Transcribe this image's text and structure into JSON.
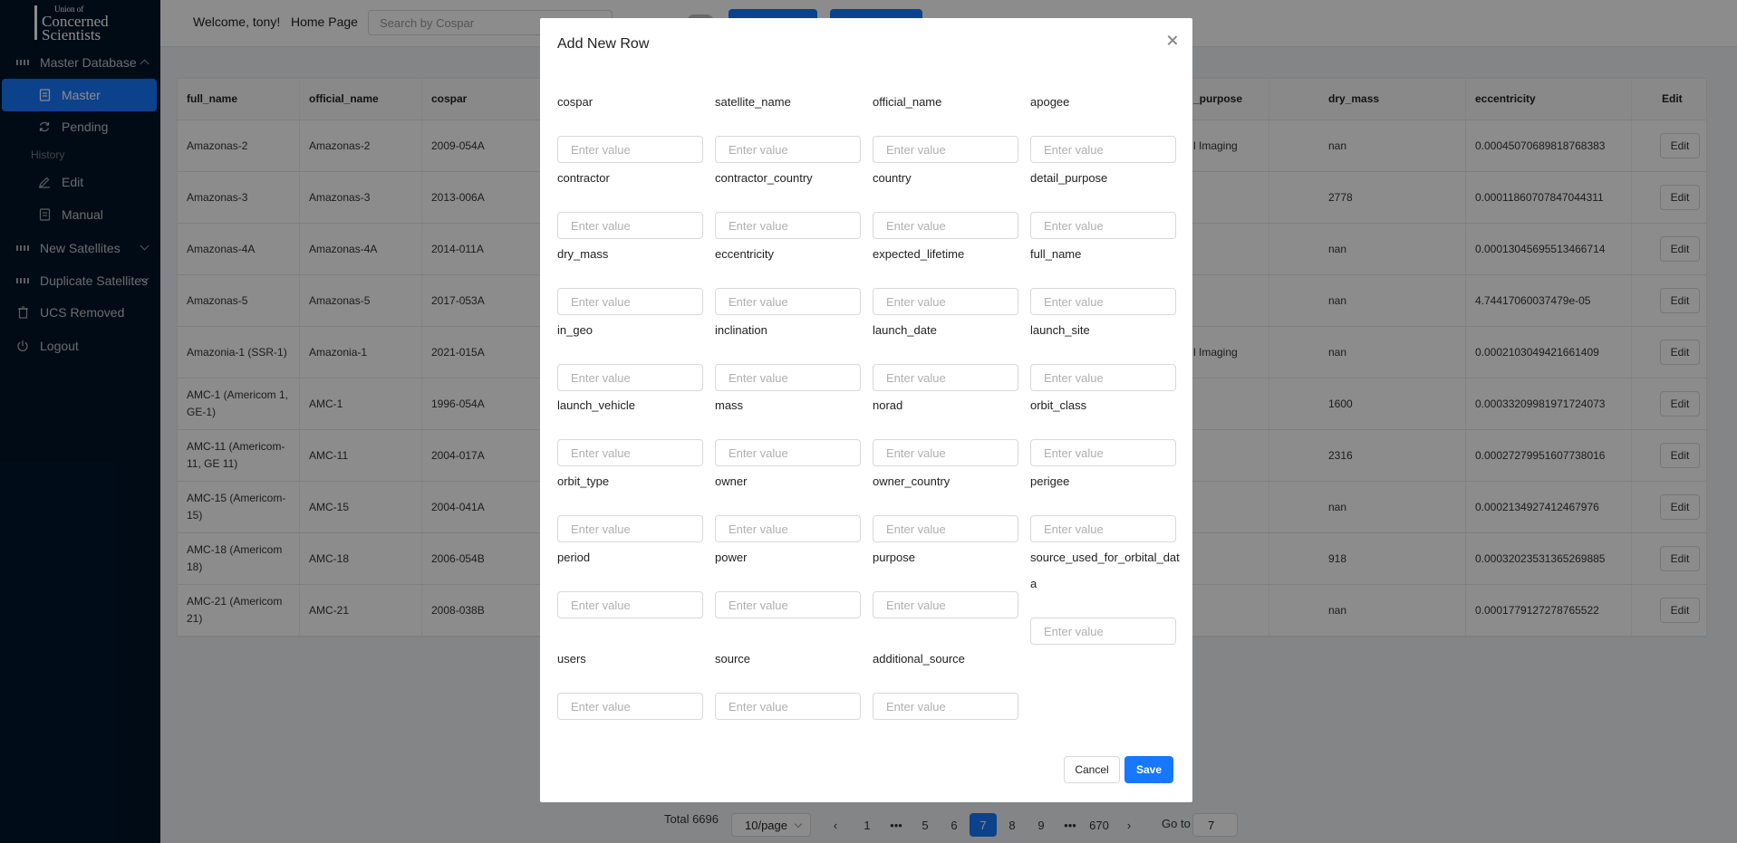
{
  "logo": {
    "line1": "Union of",
    "line2": "Concerned",
    "line3": "Scientists"
  },
  "sidebar": {
    "master_database": "Master Database",
    "master": "Master",
    "pending": "Pending",
    "history_label": "History",
    "edit": "Edit",
    "manual": "Manual",
    "new_satellites": "New Satellites",
    "duplicate_satellites": "Duplicate Satellites",
    "ucs_removed": "UCS Removed",
    "logout": "Logout"
  },
  "header": {
    "welcome": "Welcome, tony!",
    "home": "Home Page",
    "search_placeholder": "Search by Cospar"
  },
  "table": {
    "columns": [
      "full_name",
      "official_name",
      "cospar",
      "_purpose",
      "dry_mass",
      "eccentricity",
      "Edit"
    ],
    "rows": [
      {
        "full_name": "Amazonas-2",
        "official_name": "Amazonas-2",
        "cospar": "2009-054A",
        "purpose": "l Imaging",
        "dry_mass": "nan",
        "eccentricity": "0.00045070689818768383",
        "edit": "Edit"
      },
      {
        "full_name": "Amazonas-3",
        "official_name": "Amazonas-3",
        "cospar": "2013-006A",
        "purpose": "",
        "dry_mass": "2778",
        "eccentricity": "0.00011860707847044311",
        "edit": "Edit"
      },
      {
        "full_name": "Amazonas-4A",
        "official_name": "Amazonas-4A",
        "cospar": "2014-011A",
        "purpose": "",
        "dry_mass": "nan",
        "eccentricity": "0.00013045695513466714",
        "edit": "Edit"
      },
      {
        "full_name": "Amazonas-5",
        "official_name": "Amazonas-5",
        "cospar": "2017-053A",
        "purpose": "",
        "dry_mass": "nan",
        "eccentricity": "4.74417060037479e-05",
        "edit": "Edit"
      },
      {
        "full_name": "Amazonia-1 (SSR-1)",
        "official_name": "Amazonia-1",
        "cospar": "2021-015A",
        "purpose": "l Imaging",
        "dry_mass": "nan",
        "eccentricity": "0.0002103049421661409",
        "edit": "Edit"
      },
      {
        "full_name": "AMC-1 (Americom 1, GE-1)",
        "official_name": "AMC-1",
        "cospar": "1996-054A",
        "purpose": "",
        "dry_mass": "1600",
        "eccentricity": "0.00033209981971724073",
        "edit": "Edit"
      },
      {
        "full_name": "AMC-11 (Americom-11, GE 11)",
        "official_name": "AMC-11",
        "cospar": "2004-017A",
        "purpose": "",
        "dry_mass": "2316",
        "eccentricity": "0.00027279951607738016",
        "edit": "Edit"
      },
      {
        "full_name": "AMC-15 (Americom-15)",
        "official_name": "AMC-15",
        "cospar": "2004-041A",
        "purpose": "",
        "dry_mass": "nan",
        "eccentricity": "0.0002134927412467976",
        "edit": "Edit"
      },
      {
        "full_name": "AMC-18 (Americom 18)",
        "official_name": "AMC-18",
        "cospar": "2006-054B",
        "purpose": "",
        "dry_mass": "918",
        "eccentricity": "0.00032023531365269885",
        "edit": "Edit"
      },
      {
        "full_name": "AMC-21 (Americom 21)",
        "official_name": "AMC-21",
        "cospar": "2008-038B",
        "purpose": "",
        "dry_mass": "nan",
        "eccentricity": "0.0001779127278765522",
        "edit": "Edit"
      }
    ]
  },
  "pagination": {
    "total": "Total 6696",
    "page_size": "10/page",
    "prev": "‹",
    "next": "›",
    "pages": [
      "1",
      "•••",
      "5",
      "6",
      "7",
      "8",
      "9",
      "•••",
      "670"
    ],
    "current": "7",
    "goto_label": "Go to",
    "goto_value": "7"
  },
  "modal": {
    "title": "Add New Row",
    "placeholder": "Enter value",
    "fields": [
      "cospar",
      "satellite_name",
      "official_name",
      "apogee",
      "contractor",
      "contractor_country",
      "country",
      "detail_purpose",
      "dry_mass",
      "eccentricity",
      "expected_lifetime",
      "full_name",
      "in_geo",
      "inclination",
      "launch_date",
      "launch_site",
      "launch_vehicle",
      "mass",
      "norad",
      "orbit_class",
      "orbit_type",
      "owner",
      "owner_country",
      "perigee",
      "period",
      "power",
      "purpose",
      "source_used_for_orbital_data",
      "users",
      "source",
      "additional_source"
    ],
    "cancel": "Cancel",
    "save": "Save"
  },
  "colors": {
    "primary": "#1677ff",
    "sidebar_bg": "#001529",
    "overlay": "rgba(0,0,0,0.45)"
  }
}
